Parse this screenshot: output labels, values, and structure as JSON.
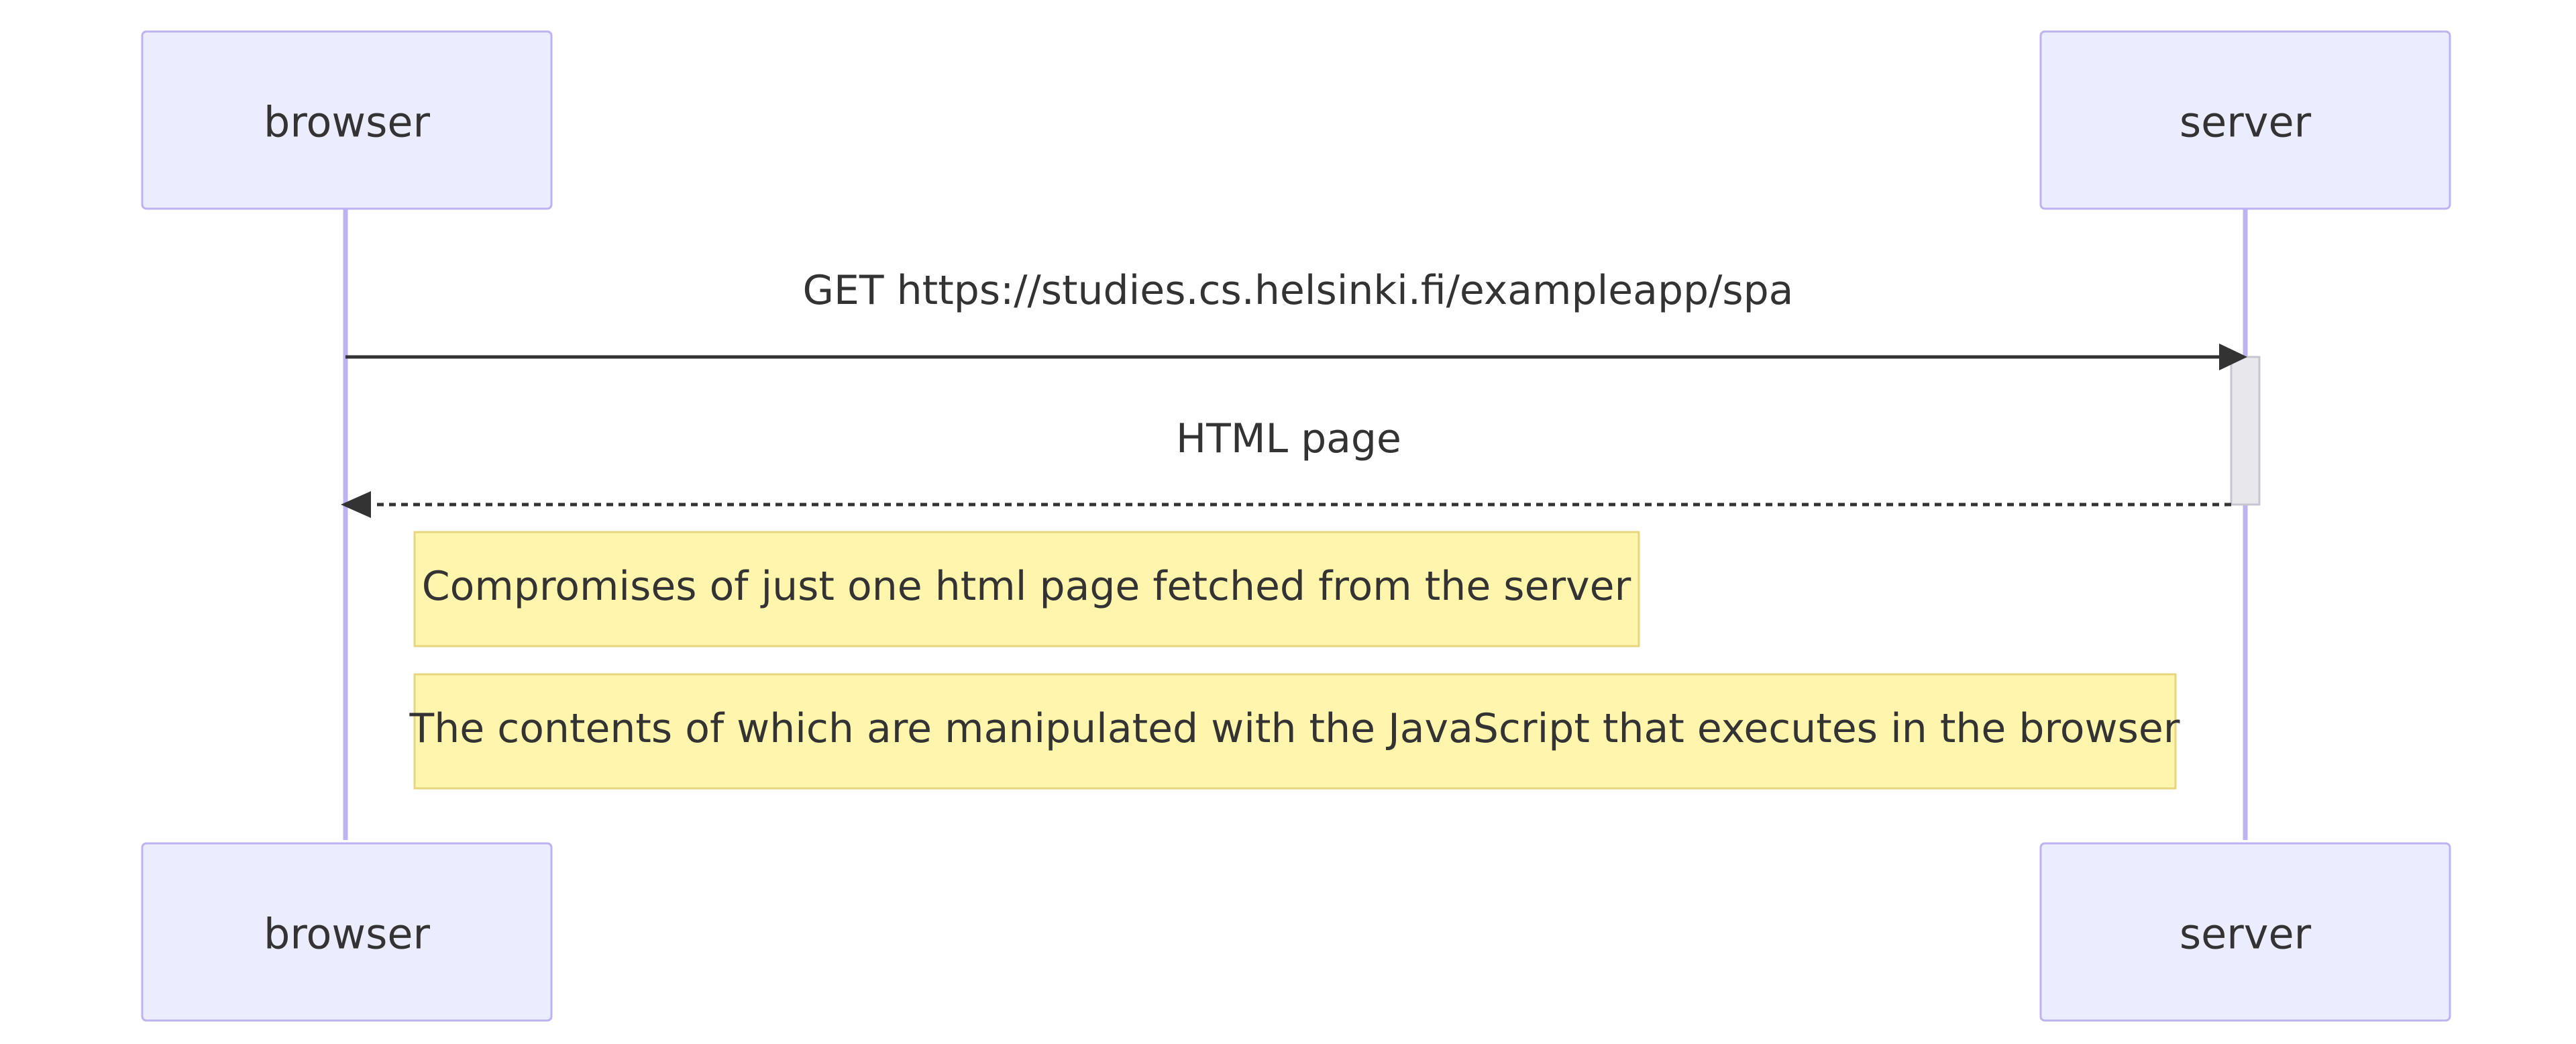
{
  "participants": {
    "browser": "browser",
    "server": "server"
  },
  "messages": [
    {
      "from": "browser",
      "to": "server",
      "style": "solid",
      "label": "GET https://studies.cs.helsinki.fi/exampleapp/spa"
    },
    {
      "from": "server",
      "to": "browser",
      "style": "dashed",
      "label": "HTML page"
    }
  ],
  "notes": [
    {
      "text": "Compromises of just one html page fetched from the server"
    },
    {
      "text": "The contents of which are manipulated with the JavaScript that executes in the browser"
    }
  ],
  "colors": {
    "actor_fill": "#ECECFF",
    "actor_border": "#BCB3F0",
    "note_fill": "#FFF5AD",
    "note_border": "#E6D77F",
    "line": "#333333"
  }
}
